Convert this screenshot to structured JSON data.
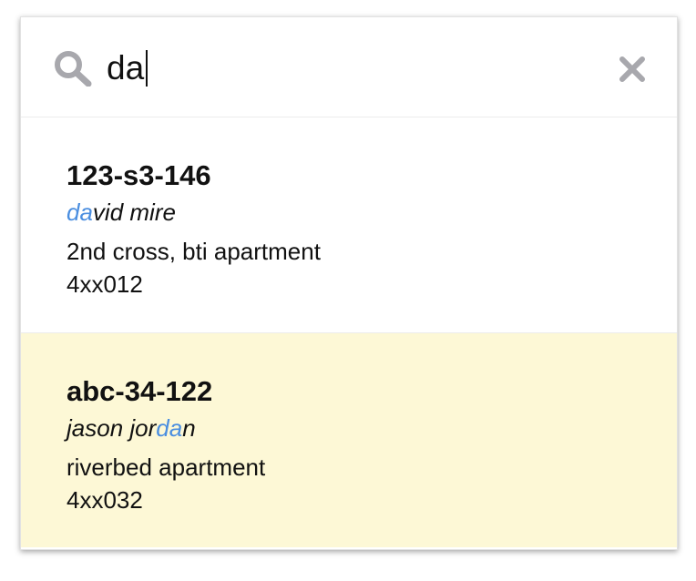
{
  "search": {
    "query": "da",
    "icon": "search-icon",
    "clear_icon": "close-icon"
  },
  "results": [
    {
      "id": "123-s3-146",
      "name_before": "",
      "name_match": "da",
      "name_after": "vid mire",
      "address": "2nd cross, bti apartment",
      "zip": "4xx012",
      "highlighted": false
    },
    {
      "id": "abc-34-122",
      "name_before": "jason jor",
      "name_match": "da",
      "name_after": "n",
      "address": "riverbed apartment",
      "zip": "4xx032",
      "highlighted": true
    }
  ],
  "colors": {
    "match_highlight": "#4a8ee0",
    "selected_row_background": "#fdf8d6",
    "icon_gray": "#a8a8ad"
  }
}
